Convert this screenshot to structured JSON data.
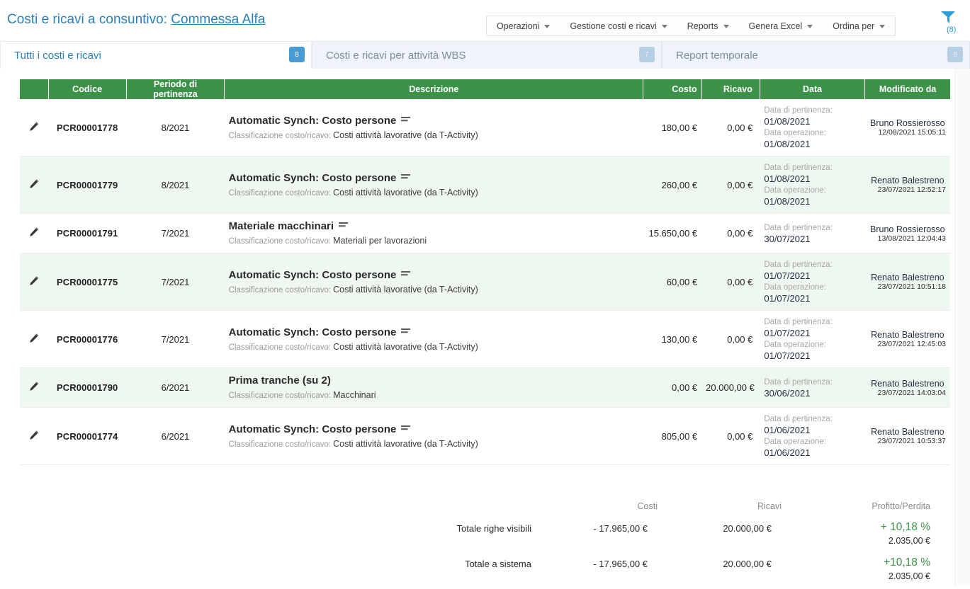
{
  "header": {
    "title_prefix": "Costi e ricavi a consuntivo:",
    "project_name": "Commessa Alfa",
    "accent_color": "#2980b9",
    "filter_icon": "funnel-icon",
    "filter_count": "(8)"
  },
  "menubar": {
    "items": [
      {
        "label": "Operazioni",
        "icon": "chevron-down-icon"
      },
      {
        "label": "Gestione costi e ricavi",
        "icon": "chevron-down-icon"
      },
      {
        "label": "Reports",
        "icon": "chevron-down-icon"
      },
      {
        "label": "Genera Excel",
        "icon": "chevron-down-icon"
      },
      {
        "label": "Ordina per",
        "icon": "chevron-down-icon"
      }
    ]
  },
  "tabs": [
    {
      "label": "Tutti i costi e ricavi",
      "badge": "8",
      "active": true
    },
    {
      "label": "Costi e ricavi per attività WBS",
      "badge": "7",
      "active": false
    },
    {
      "label": "Report temporale",
      "badge": "8",
      "active": false
    }
  ],
  "table": {
    "header_color": "#3c9248",
    "columns": [
      {
        "label": "",
        "key": "edit"
      },
      {
        "label": "Codice",
        "key": "code"
      },
      {
        "label": "Periodo di pertinenza",
        "key": "period"
      },
      {
        "label": "Descrizione",
        "key": "desc"
      },
      {
        "label": "Costo",
        "key": "cost"
      },
      {
        "label": "Ricavo",
        "key": "revenue"
      },
      {
        "label": "Data",
        "key": "date"
      },
      {
        "label": "Modificato da",
        "key": "modified_by"
      }
    ],
    "classification_label": "Classificazione costo/ricavo:",
    "date_labels": {
      "pertinenza": "Data di pertinenza:",
      "operazione": "Data operazione:"
    },
    "cost_color": "#e8736c",
    "revenue_color": "#4aa45c",
    "rows": [
      {
        "edit_icon": "pencil-icon",
        "code": "PCR00001778",
        "period": "8/2021",
        "title": "Automatic Synch: Costo persone",
        "note_icon": "note-lines-icon",
        "classification": "Costi attività lavorative (da T-Activity)",
        "cost": "180,00 €",
        "revenue": "0,00 €",
        "date_pertinenza": "01/08/2021",
        "date_operazione": "01/08/2021",
        "modified_by": "Bruno Rossierosso",
        "modified_at": "12/08/2021 15:05:11"
      },
      {
        "edit_icon": "pencil-icon",
        "code": "PCR00001779",
        "period": "8/2021",
        "title": "Automatic Synch: Costo persone",
        "note_icon": "note-lines-icon",
        "classification": "Costi attività lavorative (da T-Activity)",
        "cost": "260,00 €",
        "revenue": "0,00 €",
        "date_pertinenza": "01/08/2021",
        "date_operazione": "01/08/2021",
        "modified_by": "Renato Balestreno",
        "modified_at": "23/07/2021 12:52:17"
      },
      {
        "edit_icon": "pencil-icon",
        "code": "PCR00001791",
        "period": "7/2021",
        "title": "Materiale macchinari",
        "note_icon": "note-lines-icon",
        "classification": "Materiali per lavorazioni",
        "cost": "15.650,00 €",
        "revenue": "0,00 €",
        "date_pertinenza": "30/07/2021",
        "date_operazione": "",
        "modified_by": "Bruno Rossierosso",
        "modified_at": "13/08/2021 12:04:43"
      },
      {
        "edit_icon": "pencil-icon",
        "code": "PCR00001775",
        "period": "7/2021",
        "title": "Automatic Synch: Costo persone",
        "note_icon": "note-lines-icon",
        "classification": "Costi attività lavorative (da T-Activity)",
        "cost": "60,00 €",
        "revenue": "0,00 €",
        "date_pertinenza": "01/07/2021",
        "date_operazione": "01/07/2021",
        "modified_by": "Renato Balestreno",
        "modified_at": "23/07/2021 10:51:18"
      },
      {
        "edit_icon": "pencil-icon",
        "code": "PCR00001776",
        "period": "7/2021",
        "title": "Automatic Synch: Costo persone",
        "note_icon": "note-lines-icon",
        "classification": "Costi attività lavorative (da T-Activity)",
        "cost": "130,00 €",
        "revenue": "0,00 €",
        "date_pertinenza": "01/07/2021",
        "date_operazione": "01/07/2021",
        "modified_by": "Renato Balestreno",
        "modified_at": "23/07/2021 12:45:03"
      },
      {
        "edit_icon": "pencil-icon",
        "code": "PCR00001790",
        "period": "6/2021",
        "title": "Prima tranche (su 2)",
        "note_icon": "",
        "classification": "Macchinari",
        "cost": "0,00 €",
        "revenue": "20.000,00 €",
        "date_pertinenza": "30/06/2021",
        "date_operazione": "",
        "modified_by": "Renato Balestreno",
        "modified_at": "23/07/2021 14:03:04"
      },
      {
        "edit_icon": "pencil-icon",
        "code": "PCR00001774",
        "period": "6/2021",
        "title": "Automatic Synch: Costo persone",
        "note_icon": "note-lines-icon",
        "classification": "Costi attività lavorative (da T-Activity)",
        "cost": "805,00 €",
        "revenue": "0,00 €",
        "date_pertinenza": "01/06/2021",
        "date_operazione": "01/06/2021",
        "modified_by": "Renato Balestreno",
        "modified_at": "23/07/2021 10:53:37"
      }
    ]
  },
  "totals": {
    "col_costs": "Costi",
    "col_revenues": "Ricavi",
    "col_pl": "Profitto/Perdita",
    "rows": [
      {
        "label": "Totale righe visibili",
        "costs": "- 17.965,00 €",
        "revenues": "20.000,00 €",
        "pl_pct": "+ 10,18 %",
        "pl_abs": "2.035,00 €"
      },
      {
        "label": "Totale a sistema",
        "costs": "- 17.965,00 €",
        "revenues": "20.000,00 €",
        "pl_pct": "+10,18 %",
        "pl_abs": "2.035,00 €"
      }
    ],
    "pl_color": "#3c9248"
  }
}
